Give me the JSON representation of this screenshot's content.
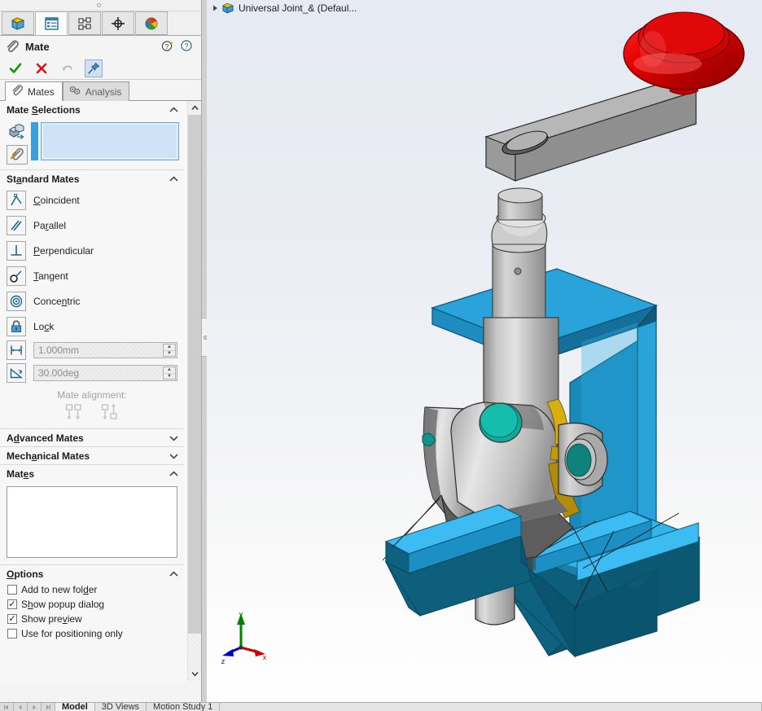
{
  "window": {
    "manager_tabs": [
      {
        "name": "feature-manager-tree",
        "title": "FeatureManager design tree"
      },
      {
        "name": "property-manager",
        "title": "PropertyManager"
      },
      {
        "name": "configuration-manager",
        "title": "ConfigurationManager"
      },
      {
        "name": "dimxpert-manager",
        "title": "DimXpertManager"
      },
      {
        "name": "display-manager",
        "title": "DisplayManager"
      }
    ],
    "active_manager_tab": 1
  },
  "property_manager": {
    "title": "Mate",
    "icon": "mate-paperclip-icon",
    "help_icons": [
      "whats-new-help-icon",
      "help-icon"
    ],
    "actions": [
      {
        "name": "ok-button",
        "icon": "green-check-icon",
        "label": "OK"
      },
      {
        "name": "cancel-button",
        "icon": "red-x-icon",
        "label": "Cancel"
      },
      {
        "name": "undo-button",
        "icon": "undo-arrow-icon",
        "label": "Undo"
      },
      {
        "name": "pin-button",
        "icon": "pushpin-icon",
        "label": "Keep Visible",
        "pressed": true
      }
    ],
    "sub_tabs": [
      {
        "label": "Mates",
        "icon": "paperclip-icon",
        "active": true
      },
      {
        "label": "Analysis",
        "icon": "analysis-icon",
        "active": false
      }
    ],
    "groups": {
      "mate_selections": {
        "label": "Mate Selections",
        "underline_index": 5,
        "collapsed": false,
        "entities_icon": "entities-to-mate-icon",
        "multiple_mate_icon": "multiple-mate-mode-icon",
        "selection_value": "",
        "selection_placeholder": ""
      },
      "standard_mates": {
        "label": "Standard Mates",
        "collapsed": false,
        "items": [
          {
            "label": "Coincident",
            "icon": "coincident-icon",
            "accel": "C"
          },
          {
            "label": "Parallel",
            "icon": "parallel-icon",
            "accel": "r"
          },
          {
            "label": "Perpendicular",
            "icon": "perpendicular-icon",
            "accel": "P"
          },
          {
            "label": "Tangent",
            "icon": "tangent-icon",
            "accel": "T"
          },
          {
            "label": "Concentric",
            "icon": "concentric-icon",
            "accel": "n"
          },
          {
            "label": "Lock",
            "icon": "lock-icon",
            "accel": "c"
          }
        ],
        "distance": {
          "icon": "distance-icon",
          "value": "1.000mm",
          "name": "distance-field"
        },
        "angle": {
          "icon": "angle-icon",
          "value": "30.00deg",
          "name": "angle-field"
        },
        "alignment_label": "Mate alignment:",
        "alignment_buttons": [
          {
            "name": "aligned-button",
            "icon": "mate-aligned-icon"
          },
          {
            "name": "anti-aligned-button",
            "icon": "mate-anti-aligned-icon"
          }
        ]
      },
      "advanced_mates": {
        "label": "Advanced Mates",
        "collapsed": true
      },
      "mechanical_mates": {
        "label": "Mechanical Mates",
        "collapsed": true
      },
      "mates": {
        "label": "Mates",
        "collapsed": false,
        "items": []
      },
      "options": {
        "label": "Options",
        "collapsed": false,
        "items": [
          {
            "label": "Add to new folder",
            "checked": false,
            "name": "add-to-new-folder-checkbox"
          },
          {
            "label": "Show popup dialog",
            "checked": true,
            "name": "show-popup-dialog-checkbox"
          },
          {
            "label": "Show preview",
            "checked": true,
            "name": "show-preview-checkbox"
          },
          {
            "label": "Use for positioning only",
            "checked": false,
            "name": "use-for-positioning-only-checkbox"
          }
        ]
      }
    }
  },
  "tree": {
    "expand_arrow": "triangle-right-icon",
    "doc_icon": "assembly-icon",
    "label": "Universal Joint_&  (Defaul..."
  },
  "viewport": {
    "triad": {
      "x_label": "x",
      "y_label": "y",
      "z_label": "z",
      "x_color": "#cc0000",
      "y_color": "#008000",
      "z_color": "#0000cc"
    },
    "model_colors": {
      "bracket_front": "#29a3d9",
      "bracket_side": "#1479a0",
      "bracket_dark": "#0d5c7a",
      "shaft_gray": "#b8b8b8",
      "shaft_light": "#d8d8d8",
      "shaft_dark": "#8e8e8e",
      "knob_red": "#dd0000",
      "knob_red_dark": "#a60000",
      "pin_teal": "#14a89a",
      "pin_teal_dark": "#0e7f74",
      "brass": "#c49a0a",
      "outline": "#1a1a1a"
    }
  },
  "bottom_bar": {
    "nav_buttons": [
      {
        "name": "first-tab-button",
        "icon": "first-icon"
      },
      {
        "name": "prev-tab-button",
        "icon": "prev-icon"
      },
      {
        "name": "next-tab-button",
        "icon": "next-icon"
      },
      {
        "name": "last-tab-button",
        "icon": "last-icon"
      }
    ],
    "tabs": [
      {
        "label": "Model",
        "active": true
      },
      {
        "label": "3D Views",
        "active": false
      },
      {
        "label": "Motion Study 1",
        "active": false
      }
    ]
  }
}
